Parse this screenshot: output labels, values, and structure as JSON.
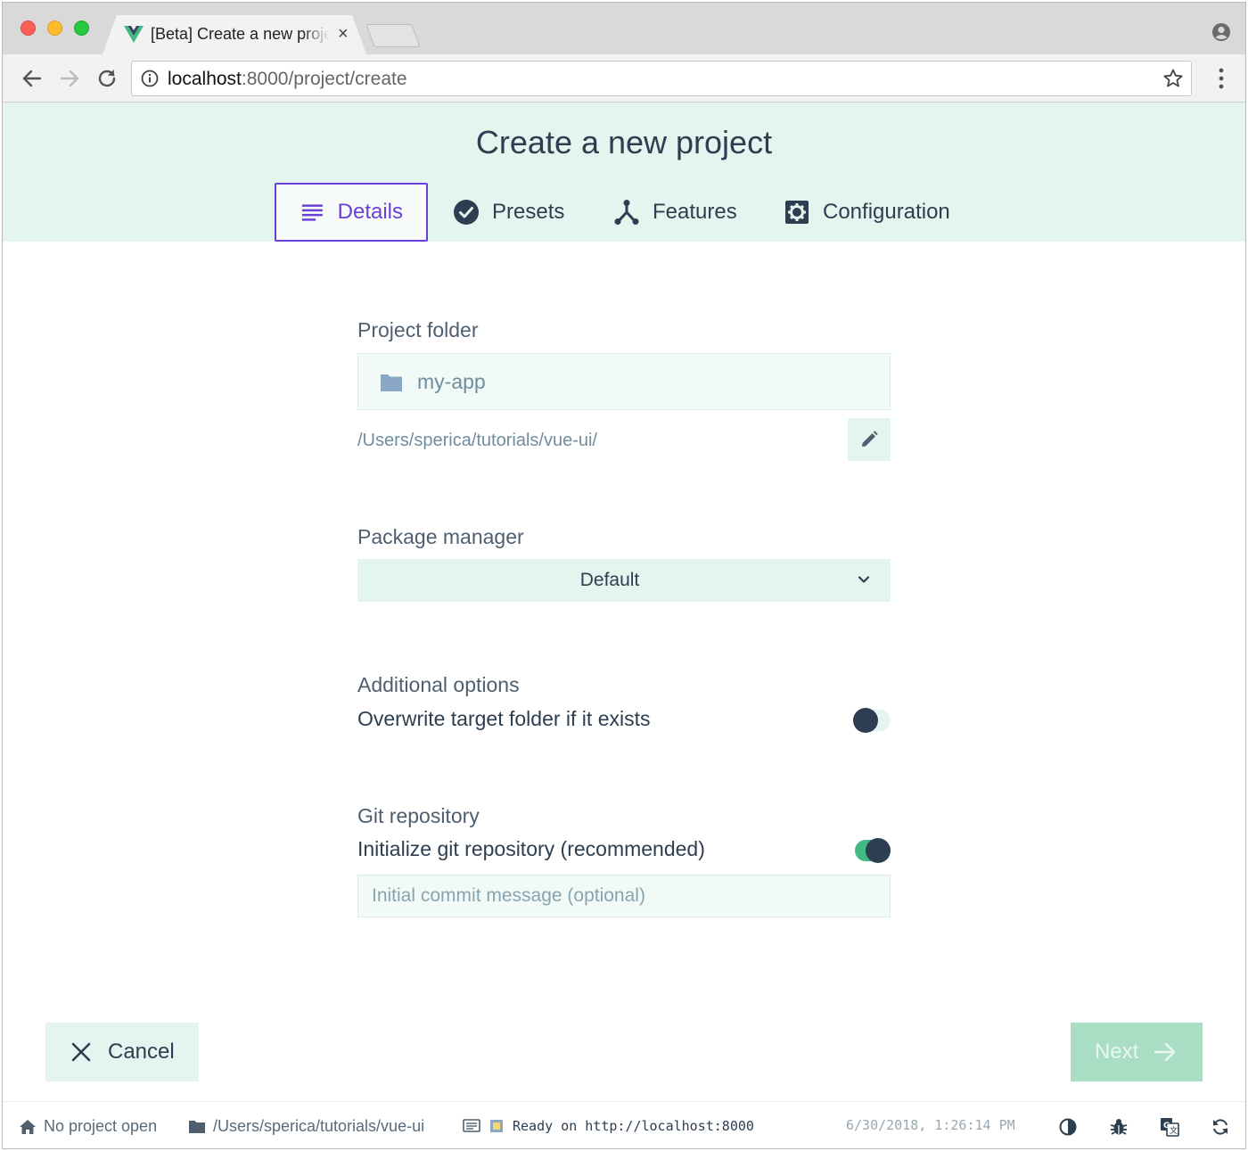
{
  "browser": {
    "tab_title": "[Beta] Create a new project",
    "tab_close": "×",
    "url_host": "localhost",
    "url_rest": ":8000/project/create"
  },
  "page": {
    "title": "Create a new project"
  },
  "steps": [
    {
      "label": "Details",
      "icon": "details-icon",
      "active": true
    },
    {
      "label": "Presets",
      "icon": "check-circle-icon",
      "active": false
    },
    {
      "label": "Features",
      "icon": "features-icon",
      "active": false
    },
    {
      "label": "Configuration",
      "icon": "settings-icon",
      "active": false
    }
  ],
  "project_folder": {
    "label": "Project folder",
    "value": "my-app",
    "path": "/Users/sperica/tutorials/vue-ui/"
  },
  "package_manager": {
    "label": "Package manager",
    "selected": "Default"
  },
  "additional_options": {
    "label": "Additional options",
    "overwrite_label": "Overwrite target folder if it exists",
    "overwrite_enabled": false
  },
  "git": {
    "label": "Git repository",
    "init_label": "Initialize git repository (recommended)",
    "init_enabled": true,
    "commit_placeholder": "Initial commit message (optional)"
  },
  "actions": {
    "cancel_label": "Cancel",
    "next_label": "Next"
  },
  "statusbar": {
    "project": "No project open",
    "cwd": "/Users/sperica/tutorials/vue-ui",
    "log": "Ready on http://localhost:8000",
    "timestamp": "6/30/2018, 1:26:14 PM"
  },
  "colors": {
    "accent": "#6a3fd8",
    "brand_green": "#42b983",
    "header_bg": "#e4f5ef",
    "text": "#2c3e50"
  }
}
